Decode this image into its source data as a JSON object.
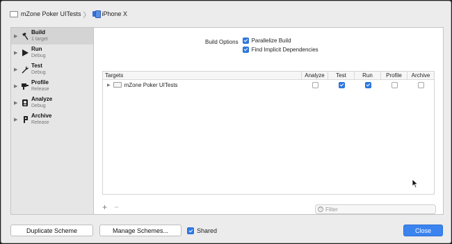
{
  "breadcrumb": {
    "scheme": "mZone Poker UITests",
    "separator": "〉",
    "device": "iPhone X"
  },
  "sidebar": {
    "items": [
      {
        "title": "Build",
        "subtitle": "1 target",
        "icon": "hammer-icon"
      },
      {
        "title": "Run",
        "subtitle": "Debug",
        "icon": "play-icon"
      },
      {
        "title": "Test",
        "subtitle": "Debug",
        "icon": "wrench-icon"
      },
      {
        "title": "Profile",
        "subtitle": "Release",
        "icon": "instruments-icon"
      },
      {
        "title": "Analyze",
        "subtitle": "Debug",
        "icon": "analyze-icon"
      },
      {
        "title": "Archive",
        "subtitle": "Release",
        "icon": "archive-icon"
      }
    ]
  },
  "build_options": {
    "label": "Build Options",
    "parallelize": {
      "label": "Parallelize Build",
      "checked": true
    },
    "implicit_deps": {
      "label": "Find Implicit Dependencies",
      "checked": true
    }
  },
  "targets_table": {
    "headers": [
      "Targets",
      "Analyze",
      "Test",
      "Run",
      "Profile",
      "Archive"
    ],
    "rows": [
      {
        "name": "mZone Poker UITests",
        "analyze": false,
        "test": true,
        "run": true,
        "profile": false,
        "archive": false
      }
    ]
  },
  "table_footer": {
    "add": "+",
    "remove": "−",
    "filter_placeholder": "Filter"
  },
  "buttons": {
    "duplicate": "Duplicate Scheme",
    "manage": "Manage Schemes...",
    "shared_label": "Shared",
    "shared_checked": true,
    "close": "Close"
  },
  "colors": {
    "accent": "#3b84ef",
    "checkbox_on": "#2f7ae5"
  }
}
